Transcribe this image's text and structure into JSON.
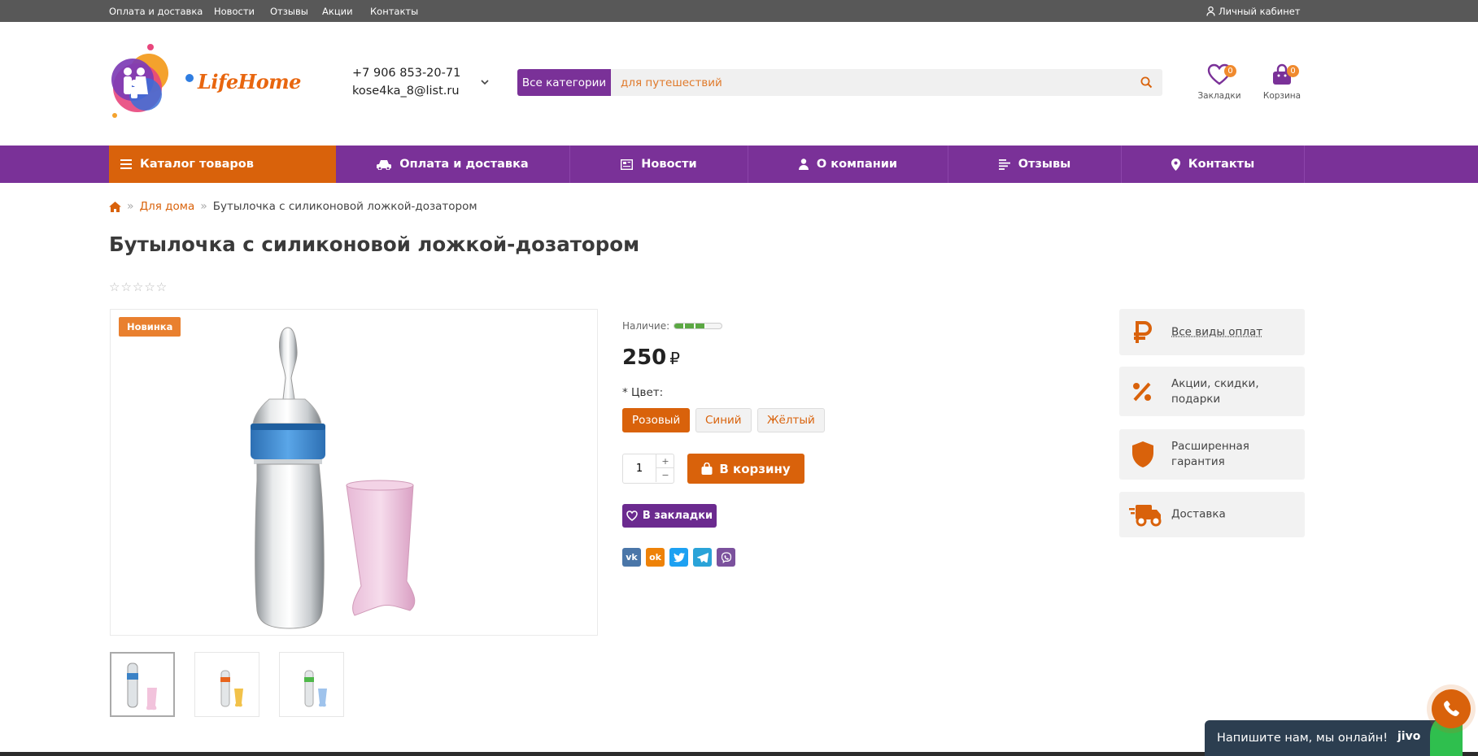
{
  "topbar": {
    "links": [
      "Оплата и доставка",
      "Новости",
      "Отзывы",
      "Акции",
      "Контакты"
    ],
    "account": "Личный кабинет"
  },
  "header": {
    "brand": "LifeHome",
    "phone": "+7 906 853-20-71",
    "email": "kose4ka_8@list.ru",
    "search": {
      "category": "Все категории",
      "placeholder": "для путешествий"
    },
    "bookmarks": {
      "label": "Закладки",
      "count": "0"
    },
    "cart": {
      "label": "Корзина",
      "count": "0"
    }
  },
  "nav": {
    "catalog": "Каталог товаров",
    "items": [
      "Оплата и доставка",
      "Новости",
      "О компании",
      "Отзывы",
      "Контакты"
    ]
  },
  "breadcrumb": {
    "home_icon": "home-icon",
    "items": [
      "Для дома",
      "Бутылочка с силиконовой ложкой-дозатором"
    ]
  },
  "product": {
    "title": "Бутылочка с силиконовой ложкой-дозатором",
    "rating": "☆☆☆☆☆",
    "badge": "Новинка",
    "availability_label": "Наличие:",
    "availability_level": 0.6,
    "price": "250",
    "currency": "₽",
    "color_label": "* Цвет:",
    "colors": [
      "Розовый",
      "Синий",
      "Жёлтый"
    ],
    "selected_color": "Розовый",
    "quantity": "1",
    "qty_plus": "+",
    "qty_minus": "−",
    "add_to_cart": "В корзину",
    "add_to_wishlist": "В закладки",
    "share": [
      "vk",
      "ok",
      "twitter",
      "telegram",
      "viber"
    ]
  },
  "features": [
    {
      "icon": "ruble-icon",
      "text": "Все виды оплат"
    },
    {
      "icon": "percent-icon",
      "text": "Акции, скидки, подарки"
    },
    {
      "icon": "shield-icon",
      "text": "Расширенная гарантия"
    },
    {
      "icon": "truck-icon",
      "text": "Доставка"
    }
  ],
  "chat": {
    "text": "Напишите нам, мы онлайн!",
    "brand": "jivo"
  },
  "colors": {
    "primary": "#7a3198",
    "accent": "#d9620b",
    "topbar": "#585858"
  }
}
